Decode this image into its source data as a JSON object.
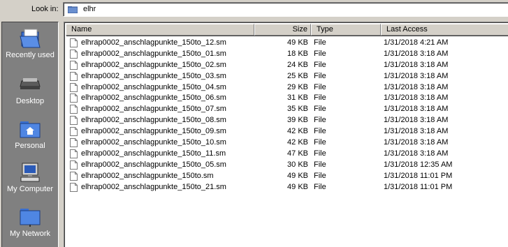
{
  "lookin": {
    "label": "Look in:",
    "value": "elhr",
    "icon": "folder-icon"
  },
  "places": [
    {
      "label": "Recently used",
      "icon": "recent-folder-icon"
    },
    {
      "label": "Desktop",
      "icon": "desktop-icon"
    },
    {
      "label": "Personal",
      "icon": "home-folder-icon"
    },
    {
      "label": "My Computer",
      "icon": "computer-icon"
    },
    {
      "label": "My Network",
      "icon": "network-folder-icon"
    }
  ],
  "columns": {
    "name": "Name",
    "size": "Size",
    "type": "Type",
    "access": "Last Access"
  },
  "files": [
    {
      "name": "elhrap0002_anschlagpunkte_150to_12.sm",
      "size": "49 KB",
      "type": "File",
      "access": "1/31/2018 4:21 AM"
    },
    {
      "name": "elhrap0002_anschlagpunkte_150to_01.sm",
      "size": "18 KB",
      "type": "File",
      "access": "1/31/2018 3:18 AM"
    },
    {
      "name": "elhrap0002_anschlagpunkte_150to_02.sm",
      "size": "24 KB",
      "type": "File",
      "access": "1/31/2018 3:18 AM"
    },
    {
      "name": "elhrap0002_anschlagpunkte_150to_03.sm",
      "size": "25 KB",
      "type": "File",
      "access": "1/31/2018 3:18 AM"
    },
    {
      "name": "elhrap0002_anschlagpunkte_150to_04.sm",
      "size": "29 KB",
      "type": "File",
      "access": "1/31/2018 3:18 AM"
    },
    {
      "name": "elhrap0002_anschlagpunkte_150to_06.sm",
      "size": "31 KB",
      "type": "File",
      "access": "1/31/2018 3:18 AM"
    },
    {
      "name": "elhrap0002_anschlagpunkte_150to_07.sm",
      "size": "35 KB",
      "type": "File",
      "access": "1/31/2018 3:18 AM"
    },
    {
      "name": "elhrap0002_anschlagpunkte_150to_08.sm",
      "size": "39 KB",
      "type": "File",
      "access": "1/31/2018 3:18 AM"
    },
    {
      "name": "elhrap0002_anschlagpunkte_150to_09.sm",
      "size": "42 KB",
      "type": "File",
      "access": "1/31/2018 3:18 AM"
    },
    {
      "name": "elhrap0002_anschlagpunkte_150to_10.sm",
      "size": "42 KB",
      "type": "File",
      "access": "1/31/2018 3:18 AM"
    },
    {
      "name": "elhrap0002_anschlagpunkte_150to_11.sm",
      "size": "47 KB",
      "type": "File",
      "access": "1/31/2018 3:18 AM"
    },
    {
      "name": "elhrap0002_anschlagpunkte_150to_05.sm",
      "size": "30 KB",
      "type": "File",
      "access": "1/31/2018 12:35 AM"
    },
    {
      "name": "elhrap0002_anschlagpunkte_150to.sm",
      "size": "49 KB",
      "type": "File",
      "access": "1/31/2018 11:01 PM"
    },
    {
      "name": "elhrap0002_anschlagpunkte_150to_21.sm",
      "size": "49 KB",
      "type": "File",
      "access": "1/31/2018 11:01 PM"
    }
  ]
}
